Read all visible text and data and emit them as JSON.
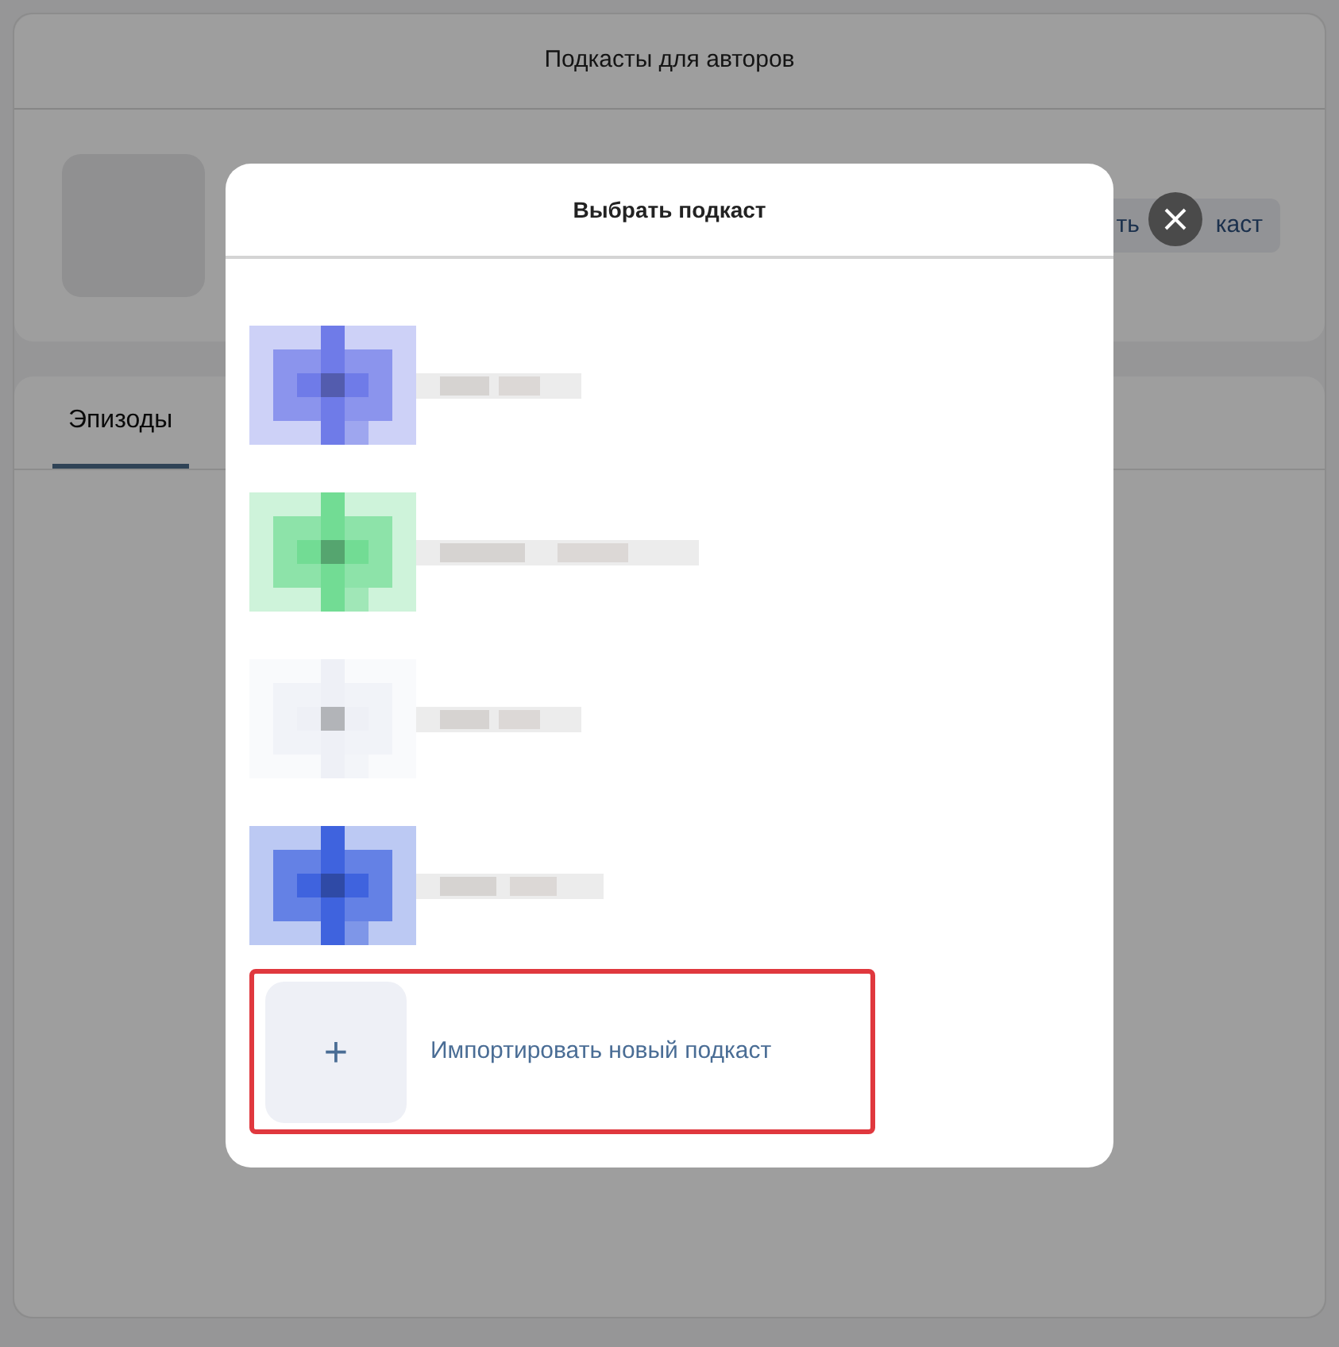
{
  "page": {
    "title": "Подкасты для авторов",
    "action_button": [
      "ть",
      "каст"
    ],
    "tabs": [
      {
        "label": "Эпизоды",
        "selected": true
      }
    ]
  },
  "modal": {
    "title": "Выбрать подкаст",
    "import": {
      "icon": "+",
      "label": "Импортировать новый подкаст",
      "highlighted": true
    }
  }
}
